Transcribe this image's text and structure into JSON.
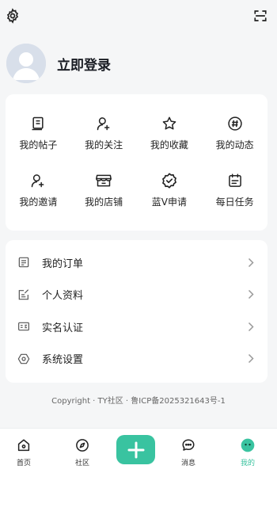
{
  "icons": {
    "settings": "gear-icon",
    "scan": "scan-icon"
  },
  "profile": {
    "login_label": "立即登录"
  },
  "grid": [
    {
      "label": "我的帖子",
      "icon": "post-icon"
    },
    {
      "label": "我的关注",
      "icon": "follow-icon"
    },
    {
      "label": "我的收藏",
      "icon": "star-icon"
    },
    {
      "label": "我的动态",
      "icon": "hashtag-icon"
    },
    {
      "label": "我的邀请",
      "icon": "invite-icon"
    },
    {
      "label": "我的店铺",
      "icon": "store-icon"
    },
    {
      "label": "蓝V申请",
      "icon": "verified-badge-icon"
    },
    {
      "label": "每日任务",
      "icon": "calendar-icon"
    }
  ],
  "list": [
    {
      "label": "我的订单",
      "icon": "order-icon"
    },
    {
      "label": "个人资料",
      "icon": "edit-profile-icon"
    },
    {
      "label": "实名认证",
      "icon": "id-card-icon"
    },
    {
      "label": "系统设置",
      "icon": "settings-hex-icon"
    }
  ],
  "footer": {
    "copyright": "Copyright · TY社区 · 鲁ICP备2025321643号-1"
  },
  "tabs": [
    {
      "label": "首页",
      "icon": "home-icon",
      "active": false
    },
    {
      "label": "社区",
      "icon": "compass-icon",
      "active": false
    },
    {
      "label": "消息",
      "icon": "message-icon",
      "active": false
    },
    {
      "label": "我的",
      "icon": "mine-icon",
      "active": true
    }
  ],
  "colors": {
    "accent": "#39c3a0",
    "background": "#f5f6f7"
  }
}
